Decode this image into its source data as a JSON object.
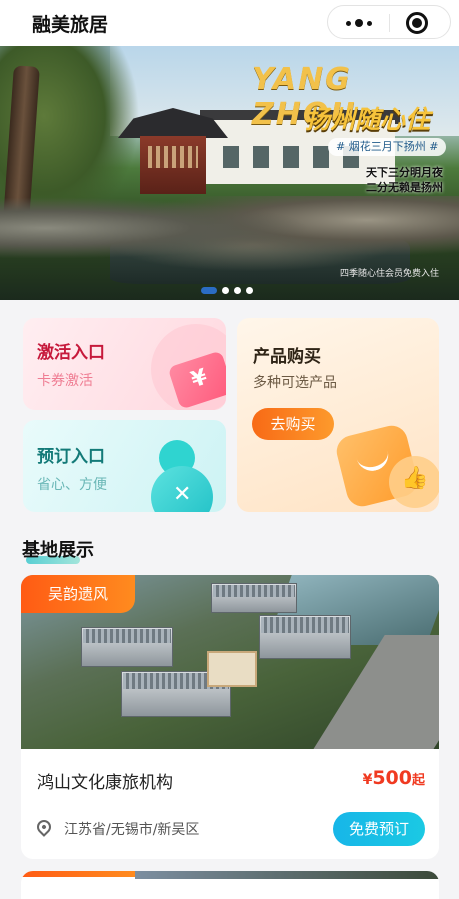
{
  "header": {
    "title": "融美旅居",
    "more_icon": "more-dots-icon",
    "close_icon": "target-close-icon"
  },
  "banner": {
    "heading_en": "YANG ZHOU",
    "heading_cn": "扬州随心住",
    "tag": "# 烟花三月下扬州 #",
    "poem_line1": "天下三分明月夜",
    "poem_line2": "二分无赖是扬州",
    "footnote": "四季随心住会员免费入住",
    "slide_count": 4,
    "active_slide": 1
  },
  "quick_entries": {
    "activate": {
      "title": "激活入口",
      "subtitle": "卡券激活",
      "icon": "ticket-icon"
    },
    "reserve": {
      "title": "预订入口",
      "subtitle": "省心、方便",
      "icon": "cross-bubble-icon"
    },
    "buy": {
      "title": "产品购买",
      "subtitle": "多种可选产品",
      "button_label": "去购买",
      "icon": "shopping-bag-icon"
    }
  },
  "section": {
    "title": "基地展示"
  },
  "listings": [
    {
      "badge": "吴韵遗风",
      "name": "鸿山文化康旅机构",
      "price_currency": "¥",
      "price_value": "500",
      "price_suffix": "起",
      "location": "江苏省/无锡市/新吴区",
      "location_icon": "location-pin-icon",
      "book_label": "免费预订"
    }
  ],
  "colors": {
    "accent_orange": "#ff6a16",
    "accent_cyan": "#17b6e8",
    "price_red": "#f03a21",
    "activate_red": "#c6193b",
    "reserve_teal": "#137a78"
  }
}
